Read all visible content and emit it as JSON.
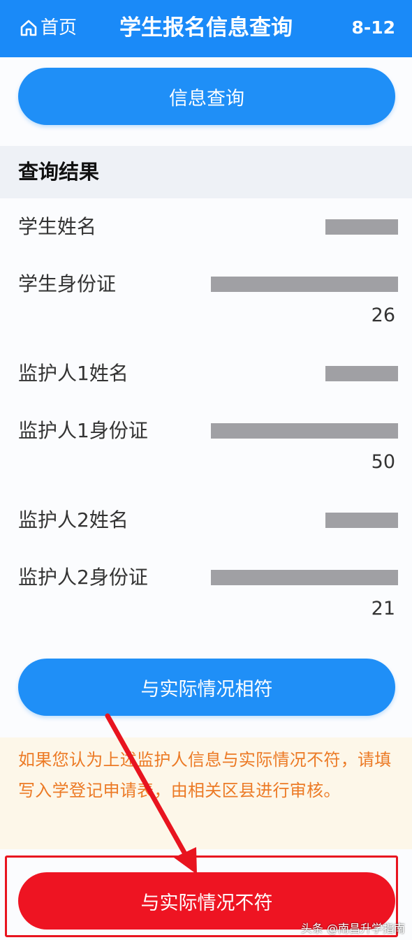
{
  "header": {
    "home_label": "首页",
    "title": "学生报名信息查询",
    "date": "8-12"
  },
  "query_button_label": "信息查询",
  "results": {
    "section_title": "查询结果",
    "rows": [
      {
        "label": "学生姓名",
        "value_tail": ""
      },
      {
        "label": "学生身份证",
        "value_tail": "26"
      },
      {
        "label": "监护人1姓名",
        "value_tail": ""
      },
      {
        "label": "监护人1身份证",
        "value_tail": "50"
      },
      {
        "label": "监护人2姓名",
        "value_tail": ""
      },
      {
        "label": "监护人2身份证",
        "value_tail": "21"
      }
    ]
  },
  "match_button_label": "与实际情况相符",
  "notice_text": "如果您认为上述监护人信息与实际情况不符，请填写入学登记申请表，由相关区县进行审核。",
  "mismatch_button_label": "与实际情况不符",
  "watermark": "头条 @南昌升学指南",
  "colors": {
    "header_blue": "#1a8af8",
    "button_blue": "#1f8ff7",
    "button_red": "#ee1422",
    "notice_orange": "#ec7a25",
    "notice_bg": "#fdf7e9",
    "arrow_red": "#e8141f"
  },
  "icons": {
    "home": "home-icon"
  }
}
